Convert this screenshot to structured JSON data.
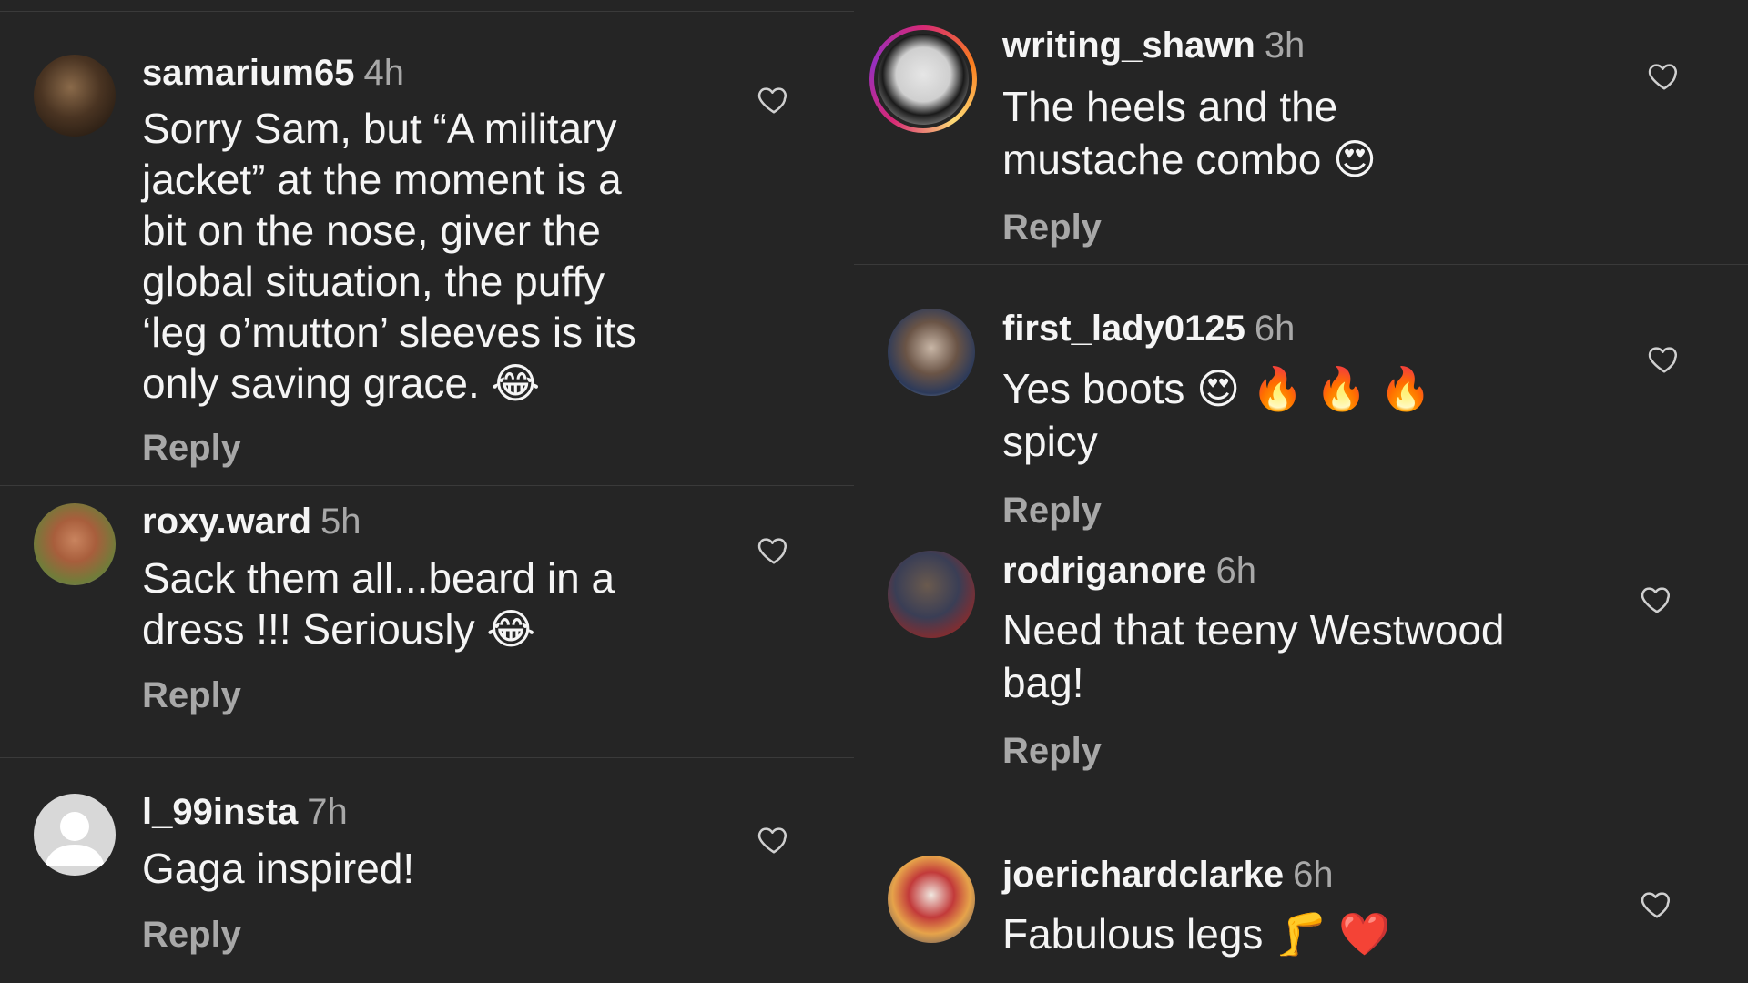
{
  "reply_label": "Reply",
  "colors": {
    "background": "#252525",
    "text": "#f5f5f5",
    "muted": "#a8a8a8",
    "divider": "#3a3a3a"
  },
  "left_comments": [
    {
      "username": "samarium65",
      "time": "4h",
      "lines": [
        "Sorry Sam, but “A military",
        "jacket” at the moment is a",
        "bit on the nose, giver the",
        "global situation, the puffy",
        "‘leg o’mutton’  sleeves is its",
        "only saving grace. 😂"
      ]
    },
    {
      "username": "roxy.ward",
      "time": "5h",
      "lines": [
        "Sack them all...beard in a",
        "dress !!! Seriously 😂"
      ]
    },
    {
      "username": "l_99insta",
      "time": "7h",
      "lines": [
        "Gaga inspired!"
      ]
    }
  ],
  "right_comments": [
    {
      "username": "writing_shawn",
      "time": "3h",
      "lines": [
        "The heels and the",
        "mustache combo 😍"
      ]
    },
    {
      "username": "first_lady0125",
      "time": "6h",
      "lines": [
        "Yes boots 😍 🔥 🔥 🔥",
        "spicy"
      ]
    },
    {
      "username": "rodriganore",
      "time": "6h",
      "lines": [
        "Need that teeny Westwood",
        "bag!"
      ]
    },
    {
      "username": "joerichardclarke",
      "time": "6h",
      "lines": [
        "Fabulous legs 🦵 ❤️"
      ]
    }
  ]
}
